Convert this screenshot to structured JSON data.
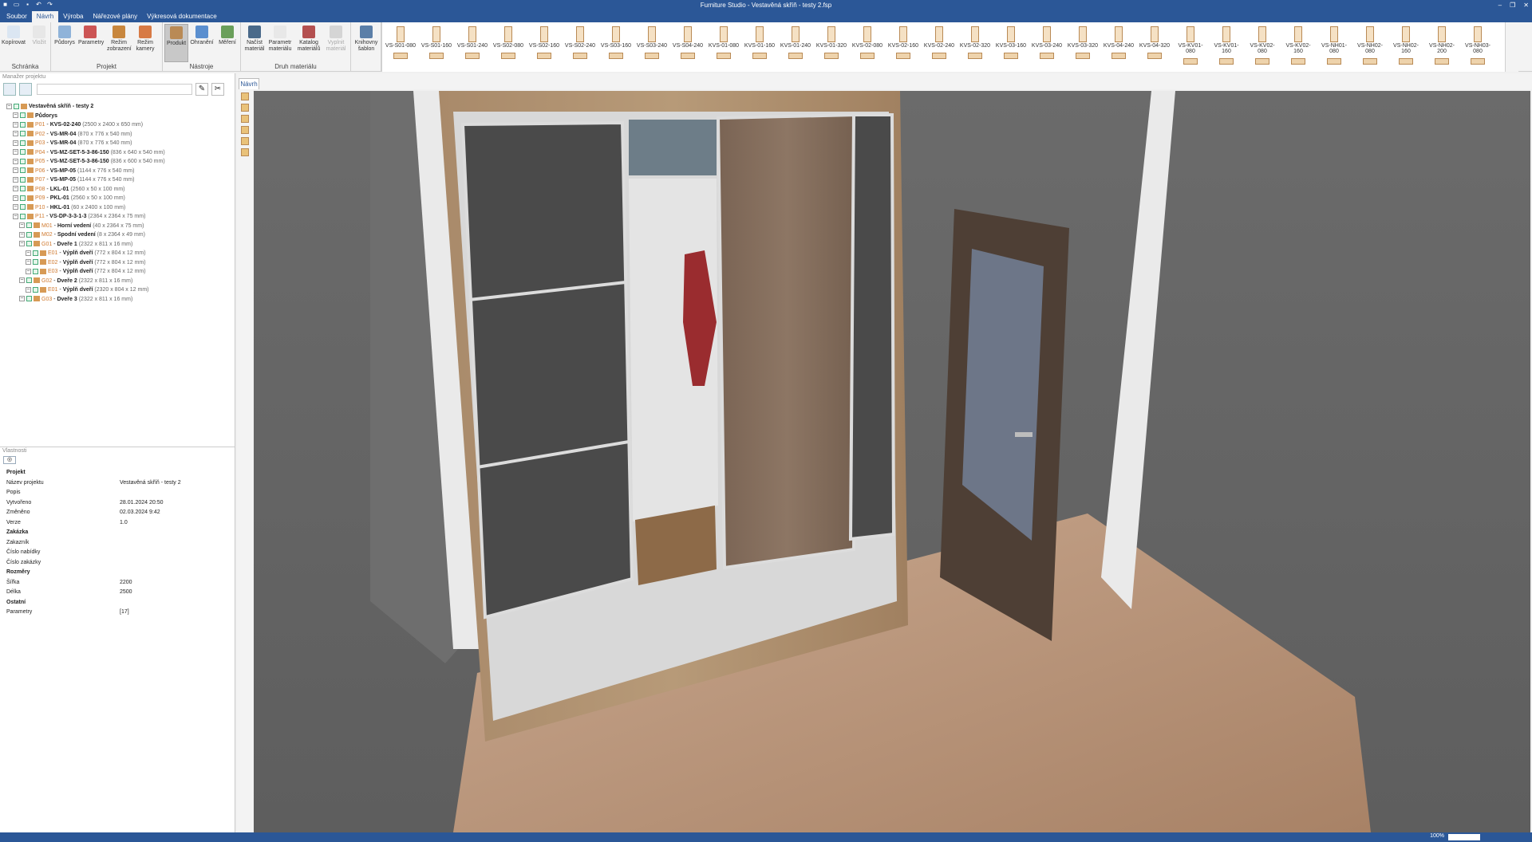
{
  "window": {
    "title": "Furniture Studio - Vestavěná skříň - testy 2.fsp"
  },
  "menu": [
    "Soubor",
    "Návrh",
    "Výroba",
    "Nářezové plány",
    "Výkresová dokumentace"
  ],
  "ribbon": {
    "groups": [
      {
        "label": "Schránka",
        "buttons": [
          "Kopírovat",
          "Vložit"
        ]
      },
      {
        "label": "Projekt",
        "buttons": [
          "Půdorys",
          "Parametry",
          "Režim zobrazení",
          "Režim kamery"
        ]
      },
      {
        "label": "Nástroje",
        "buttons": [
          "Produkt",
          "Ohranění",
          "Měření"
        ]
      },
      {
        "label": "Druh materiálu",
        "buttons": [
          "Načíst materiál",
          "Parametr materiálu",
          "Katalog materiálů",
          "Vyplnit materiál"
        ]
      },
      {
        "label": "",
        "buttons": [
          "Knihovny šablon"
        ]
      }
    ],
    "gallery": [
      "VS-S01-080",
      "VS-S01-160",
      "VS-S01-240",
      "VS-S02-080",
      "VS-S02-160",
      "VS-S02-240",
      "VS-S03-160",
      "VS-S03-240",
      "VS-S04-240",
      "KVS-01-080",
      "KVS-01-160",
      "KVS-01-240",
      "KVS-01-320",
      "KVS-02-080",
      "KVS-02-160",
      "KVS-02-240",
      "KVS-02-320",
      "KVS-03-160",
      "KVS-03-240",
      "KVS-03-320",
      "KVS-04-240",
      "KVS-04-320",
      "VS-KV01-080",
      "VS-KV01-160",
      "VS-KV02-080",
      "VS-KV02-160",
      "VS-NH01-080",
      "VS-NH02-080",
      "VS-NH02-160",
      "VS-NH02-200",
      "VS-NH03-080"
    ]
  },
  "project_manager": {
    "title": "Manažer projektu",
    "tree": [
      {
        "indent": 0,
        "code": "",
        "name": "Vestavěná skříň - testy 2",
        "dim": ""
      },
      {
        "indent": 1,
        "code": "",
        "name": "Půdorys",
        "dim": ""
      },
      {
        "indent": 1,
        "code": "P01",
        "name": "KVS-02-240",
        "dim": "(2500 x 2400 x 650 mm)"
      },
      {
        "indent": 1,
        "code": "P02",
        "name": "VS-MR-04",
        "dim": "(870 x 776 x 540 mm)"
      },
      {
        "indent": 1,
        "code": "P03",
        "name": "VS-MR-04",
        "dim": "(870 x 776 x 540 mm)"
      },
      {
        "indent": 1,
        "code": "P04",
        "name": "VS-MZ-SET-5-3-86-150",
        "dim": "(836 x 640 x 540 mm)"
      },
      {
        "indent": 1,
        "code": "P05",
        "name": "VS-MZ-SET-5-3-86-150",
        "dim": "(836 x 600 x 540 mm)"
      },
      {
        "indent": 1,
        "code": "P06",
        "name": "VS-MP-05",
        "dim": "(1144 x 776 x 540 mm)"
      },
      {
        "indent": 1,
        "code": "P07",
        "name": "VS-MP-05",
        "dim": "(1144 x 776 x 540 mm)"
      },
      {
        "indent": 1,
        "code": "P08",
        "name": "LKL-01",
        "dim": "(2560 x 50 x 100 mm)"
      },
      {
        "indent": 1,
        "code": "P09",
        "name": "PKL-01",
        "dim": "(2560 x 50 x 100 mm)"
      },
      {
        "indent": 1,
        "code": "P10",
        "name": "HKL-01",
        "dim": "(60 x 2400 x 100 mm)"
      },
      {
        "indent": 1,
        "code": "P11",
        "name": "VS-DP-3-3-1-3",
        "dim": "(2364 x 2364 x 75 mm)"
      },
      {
        "indent": 2,
        "code": "M01",
        "name": "Horní vedení",
        "dim": "(40 x 2364 x 75 mm)"
      },
      {
        "indent": 2,
        "code": "M02",
        "name": "Spodní vedení",
        "dim": "(8 x 2364 x 49 mm)"
      },
      {
        "indent": 2,
        "code": "G01",
        "name": "Dveře 1",
        "dim": "(2322 x 811 x 16 mm)"
      },
      {
        "indent": 3,
        "code": "E01",
        "name": "Výplň dveří",
        "dim": "(772 x 804 x 12 mm)"
      },
      {
        "indent": 3,
        "code": "E02",
        "name": "Výplň dveří",
        "dim": "(772 x 804 x 12 mm)"
      },
      {
        "indent": 3,
        "code": "E03",
        "name": "Výplň dveří",
        "dim": "(772 x 804 x 12 mm)"
      },
      {
        "indent": 2,
        "code": "G02",
        "name": "Dveře 2",
        "dim": "(2322 x 811 x 16 mm)"
      },
      {
        "indent": 3,
        "code": "E01",
        "name": "Výplň dveří",
        "dim": "(2320 x 804 x 12 mm)"
      },
      {
        "indent": 2,
        "code": "G03",
        "name": "Dveře 3",
        "dim": "(2322 x 811 x 16 mm)"
      }
    ]
  },
  "properties": {
    "title": "Vlastnosti",
    "rows": [
      {
        "k": "Projekt",
        "v": "",
        "sec": true
      },
      {
        "k": "Název projektu",
        "v": "Vestavěná skříň - testy 2",
        "sec": false
      },
      {
        "k": "Popis",
        "v": "",
        "sec": false
      },
      {
        "k": "Vytvořeno",
        "v": "28.01.2024 20:50",
        "sec": false
      },
      {
        "k": "Změněno",
        "v": "02.03.2024 9:42",
        "sec": false
      },
      {
        "k": "Verze",
        "v": "1.0",
        "sec": false
      },
      {
        "k": "Zakázka",
        "v": "",
        "sec": true
      },
      {
        "k": "Zakazník",
        "v": "",
        "sec": false
      },
      {
        "k": "Číslo nabídky",
        "v": "",
        "sec": false
      },
      {
        "k": "Číslo zakázky",
        "v": "",
        "sec": false
      },
      {
        "k": "Rozměry",
        "v": "",
        "sec": true
      },
      {
        "k": "Šířka",
        "v": "2200",
        "sec": false
      },
      {
        "k": "Délka",
        "v": "2500",
        "sec": false
      },
      {
        "k": "Ostatní",
        "v": "",
        "sec": true
      },
      {
        "k": "Parametry",
        "v": "[17]",
        "sec": false
      }
    ]
  },
  "view": {
    "tab": "Návrh"
  },
  "status": {
    "zoom": "100%"
  }
}
